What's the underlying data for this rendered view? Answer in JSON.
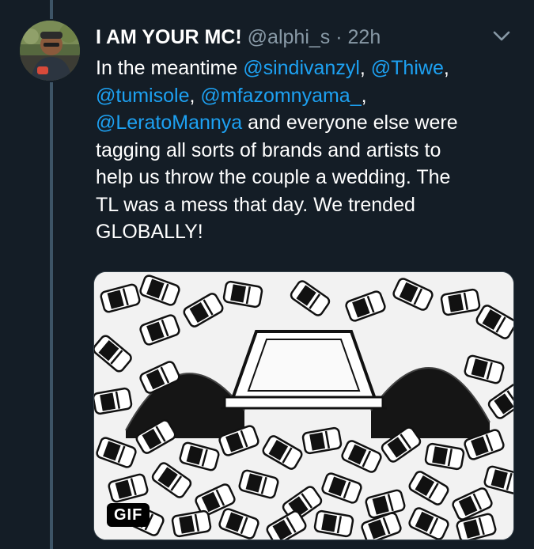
{
  "tweet": {
    "display_name": "I AM YOUR MC!",
    "handle": "@alphi_s",
    "separator": "·",
    "time": "22h",
    "text_lines": [
      [
        {
          "t": "In the meantime ",
          "m": false
        },
        {
          "t": "@sindivanzyl",
          "m": true
        },
        {
          "t": ", ",
          "m": false
        },
        {
          "t": "@Thiwe",
          "m": true
        },
        {
          "t": ",",
          "m": false
        }
      ],
      [
        {
          "t": "@tumisole",
          "m": true
        },
        {
          "t": ", ",
          "m": false
        },
        {
          "t": "@mfazomnyama_",
          "m": true
        },
        {
          "t": ",",
          "m": false
        }
      ],
      [
        {
          "t": "@LeratoMannya",
          "m": true
        },
        {
          "t": " and everyone else were",
          "m": false
        }
      ],
      [
        {
          "t": "tagging all sorts of brands and artists to",
          "m": false
        }
      ],
      [
        {
          "t": "help us throw the couple a wedding. The",
          "m": false
        }
      ],
      [
        {
          "t": "TL was a mess that day. We trended",
          "m": false
        }
      ],
      [
        {
          "t": "GLOBALLY!",
          "m": false
        }
      ]
    ],
    "media": {
      "badge": "GIF"
    }
  },
  "icons": {
    "caret": "chevron-down-icon"
  },
  "colors": {
    "background": "#141d26",
    "mention": "#1da1f2",
    "secondary_text": "#8899a6",
    "thread_line": "#3d5466"
  }
}
